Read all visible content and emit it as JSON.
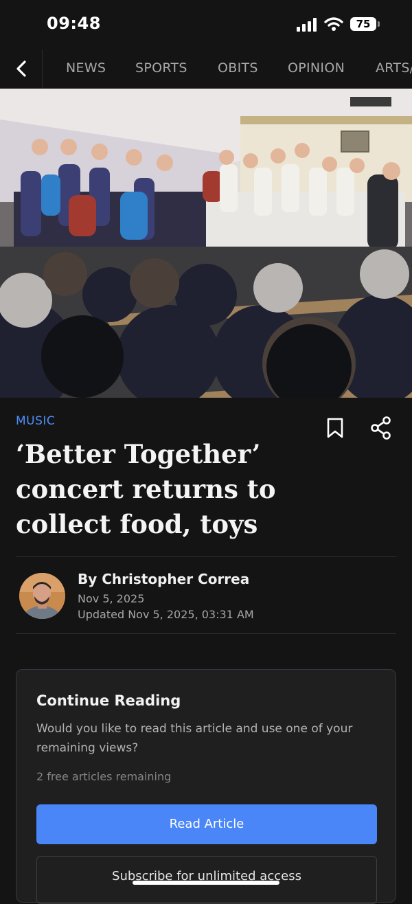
{
  "status_bar": {
    "time": "09:48",
    "battery": "75",
    "icons": [
      "signal-icon",
      "wifi-icon",
      "battery-icon"
    ]
  },
  "nav": {
    "back_icon": "chevron-left-icon",
    "items": [
      {
        "label": "NEWS"
      },
      {
        "label": "SPORTS"
      },
      {
        "label": "OBITS"
      },
      {
        "label": "OPINION"
      },
      {
        "label": "ARTS/"
      }
    ]
  },
  "article": {
    "category": "MUSIC",
    "title": "‘Better Together’ concert returns to collect food, toys",
    "author": "By Christopher Correa",
    "published": "Nov 5, 2025",
    "updated": "Updated Nov 5, 2025, 03:31 AM",
    "actions": [
      "bookmark-icon",
      "share-icon"
    ]
  },
  "paywall": {
    "heading": "Continue Reading",
    "prompt": "Would you like to read this article and use one of your remaining views?",
    "remaining": "2 free articles remaining",
    "read_label": "Read Article",
    "subscribe_label": "Subscribe for unlimited access"
  },
  "colors": {
    "background": "#141414",
    "accent": "#4a86f7",
    "category": "#4d8ef8",
    "card": "#1f1f1f"
  }
}
